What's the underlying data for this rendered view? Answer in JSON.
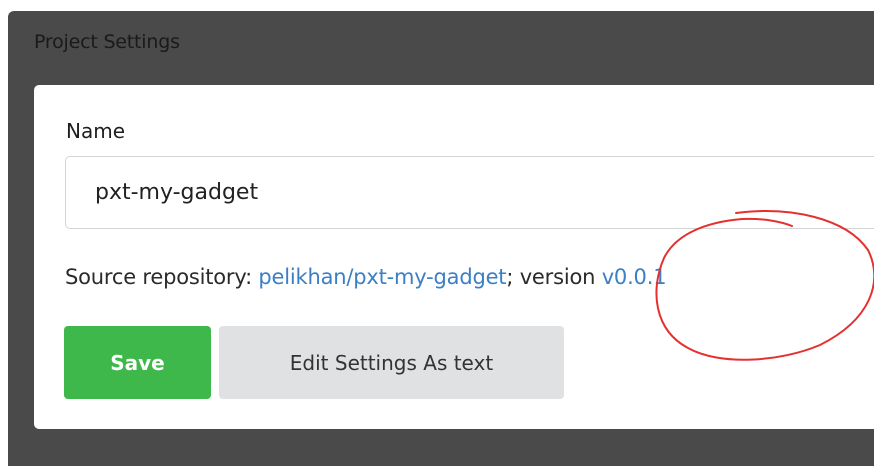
{
  "dialog": {
    "title": "Project Settings"
  },
  "form": {
    "name_label": "Name",
    "name_value": "pxt-my-gadget"
  },
  "repository": {
    "prefix": "Source repository: ",
    "repo_link": "pelikhan/pxt-my-gadget",
    "separator": "; version ",
    "version_link": "v0.0.1"
  },
  "actions": {
    "save_label": "Save",
    "edit_label": "Edit Settings As text"
  },
  "colors": {
    "overlay": "#4a4a4a",
    "link": "#3b7fc4",
    "save": "#3fb84b",
    "annotation": "#e53030"
  }
}
